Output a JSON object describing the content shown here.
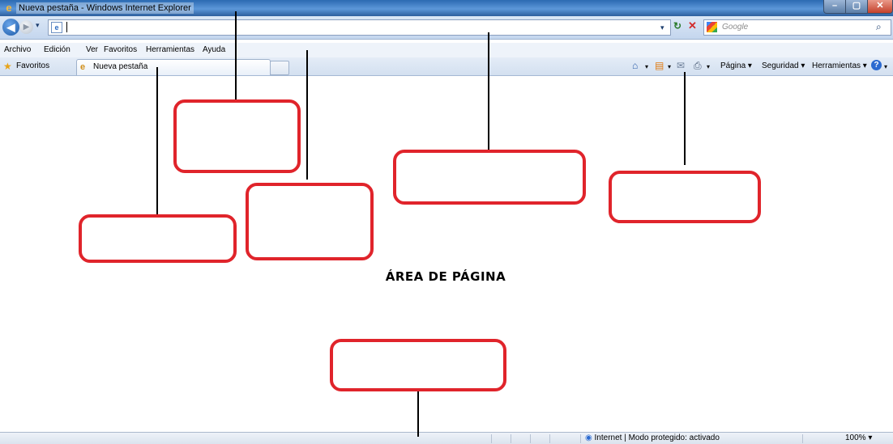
{
  "window": {
    "title": "Nueva pestaña - Windows Internet Explorer",
    "min_glyph": "–",
    "max_glyph": "▢",
    "close_glyph": "✕"
  },
  "navigation": {
    "back_glyph": "◀",
    "forward_glyph": "▶",
    "dropdown_glyph": "▾",
    "address_value": "",
    "address_page_glyph": "e",
    "refresh_glyph": "↻",
    "stop_glyph": "✕"
  },
  "search": {
    "placeholder": "Google",
    "button_glyph": "⌕"
  },
  "menu": {
    "items": [
      "Archivo",
      "Edición",
      "Ver",
      "Favoritos",
      "Herramientas",
      "Ayuda"
    ]
  },
  "favorites_bar": {
    "favorites_label": "Favoritos",
    "star_glyph": "★",
    "tab_label": "Nueva pestaña",
    "tab_icon_glyph": "e"
  },
  "command_bar": {
    "home_glyph": "⌂",
    "feeds_glyph": "▤",
    "mail_glyph": "✉",
    "print_glyph": "⎙",
    "page_label": "Página ▾",
    "safety_label": "Seguridad ▾",
    "tools_label": "Herramientas ▾",
    "help_glyph": "?",
    "arrow_glyph": "▾"
  },
  "page": {
    "heading": "ÁREA DE PÁGINA"
  },
  "status_bar": {
    "zone_text": "Internet | Modo protegido: activado",
    "zone_glyph": "◉",
    "zoom_text": "100%  ▾"
  },
  "colors": {
    "callout_border": "#e0242b",
    "title_bar": "#5c97d9",
    "chrome_bg": "#dbe7f6"
  }
}
